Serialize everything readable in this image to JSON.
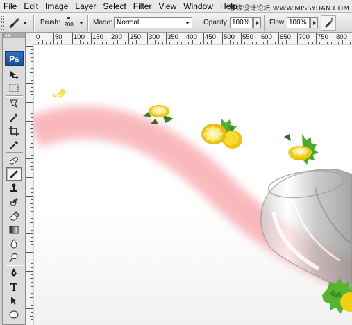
{
  "menu": {
    "items": [
      "File",
      "Edit",
      "Image",
      "Layer",
      "Select",
      "Filter",
      "View",
      "Window",
      "Help"
    ],
    "watermark": "思缘设计论坛 WWW.MISSYUAN.COM"
  },
  "options_bar": {
    "tool_icon": "brush-icon",
    "brush_label": "Brush:",
    "brush_size": "200",
    "mode_label": "Mode:",
    "mode_value": "Normal",
    "opacity_label": "Opacity:",
    "opacity_value": "100%",
    "flow_label": "Flow:",
    "flow_value": "100%",
    "airbrush_icon": "airbrush-icon"
  },
  "toolbox": {
    "logo": "Ps",
    "tools": [
      {
        "name": "move-tool-icon"
      },
      {
        "name": "marquee-tool-icon"
      },
      {
        "name": "lasso-tool-icon"
      },
      {
        "name": "magic-wand-tool-icon"
      },
      {
        "name": "crop-tool-icon"
      },
      {
        "name": "eyedropper-tool-icon"
      },
      {
        "name": "healing-brush-tool-icon"
      },
      {
        "name": "brush-tool-icon",
        "active": true
      },
      {
        "name": "clone-stamp-tool-icon"
      },
      {
        "name": "history-brush-tool-icon"
      },
      {
        "name": "eraser-tool-icon"
      },
      {
        "name": "gradient-tool-icon"
      },
      {
        "name": "blur-tool-icon"
      },
      {
        "name": "dodge-tool-icon"
      },
      {
        "name": "pen-tool-icon"
      },
      {
        "name": "type-tool-icon"
      },
      {
        "name": "path-selection-tool-icon"
      },
      {
        "name": "shape-tool-icon"
      }
    ]
  },
  "ruler": {
    "h_labels": [
      "0",
      "50",
      "100",
      "150",
      "200",
      "250",
      "300",
      "350",
      "400",
      "450",
      "500",
      "550",
      "600",
      "650",
      "700",
      "750",
      "800"
    ]
  },
  "colors": {
    "menu_bg": "#e8e8e8",
    "toolbox_bg": "#dcdcdc",
    "ps_logo": "#2f6ec1",
    "stream_pink": "#f7a3a8",
    "lemon_yellow": "#f3d51c",
    "mint_green": "#4fae2e"
  }
}
